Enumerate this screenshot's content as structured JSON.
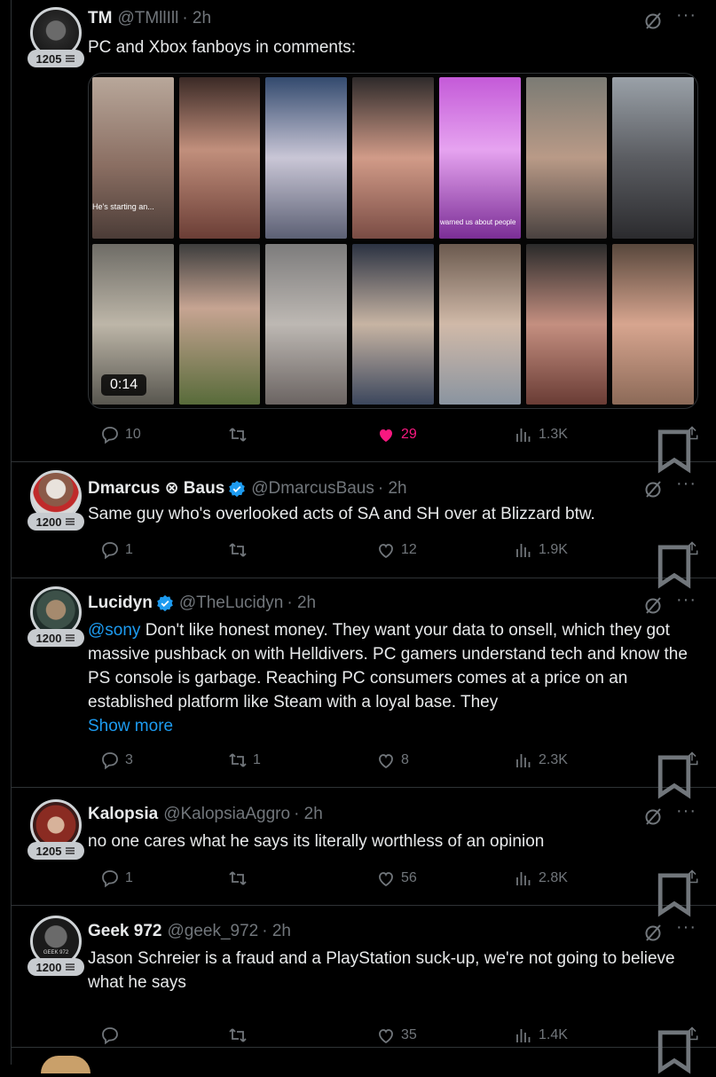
{
  "colors": {
    "accent": "#1d9bf0",
    "like": "#f91880",
    "muted": "#71767b",
    "text": "#e7e9ea"
  },
  "posts": [
    {
      "name": "TM",
      "handle": "@TMllIll",
      "time": "· 2h",
      "verified": false,
      "level": "1205",
      "text": "PC and Xbox fanboys in comments:",
      "video": {
        "duration": "0:14",
        "caption_1": "He's starting an...",
        "caption_2": "warned us about people"
      },
      "replies": "10",
      "reposts": "",
      "likes": "29",
      "liked": true,
      "views": "1.3K"
    },
    {
      "name": "Dmarcus ⊗ Baus",
      "handle": "@DmarcusBaus",
      "time": "· 2h",
      "verified": true,
      "level": "1200",
      "text": "Same guy who's overlooked acts of SA and SH over at Blizzard btw.",
      "replies": "1",
      "reposts": "",
      "likes": "12",
      "views": "1.9K"
    },
    {
      "name": "Lucidyn",
      "handle": "@TheLucidyn",
      "time": "· 2h",
      "verified": true,
      "level": "1200",
      "mention": "@sony",
      "text": " Don't like honest money. They want your data to onsell, which they got massive pushback on with Helldivers. PC gamers understand tech and know the PS console is garbage. Reaching PC consumers comes at a price on an established platform like Steam with a loyal base. They",
      "show_more": "Show more",
      "replies": "3",
      "reposts": "1",
      "likes": "8",
      "views": "2.3K"
    },
    {
      "name": "Kalopsia",
      "handle": "@KalopsiaAggro",
      "time": "· 2h",
      "verified": false,
      "level": "1205",
      "text": "no one cares what he says its literally worthless of an opinion",
      "replies": "1",
      "reposts": "",
      "likes": "56",
      "views": "2.8K"
    },
    {
      "name": "Geek 972",
      "handle": "@geek_972",
      "time": "· 2h",
      "verified": false,
      "level": "1200",
      "avatar_text": "GEEK 972",
      "text": "Jason Schreier is a fraud and a PlayStation suck-up, we're not going to believe what he says",
      "replies": "",
      "reposts": "",
      "likes": "35",
      "views": "1.4K"
    }
  ],
  "icons": [
    "reply-icon",
    "repost-icon",
    "like-icon",
    "views-icon",
    "bookmark-icon",
    "share-icon",
    "grok-icon",
    "more-icon",
    "verified-icon",
    "level-stack-icon"
  ]
}
